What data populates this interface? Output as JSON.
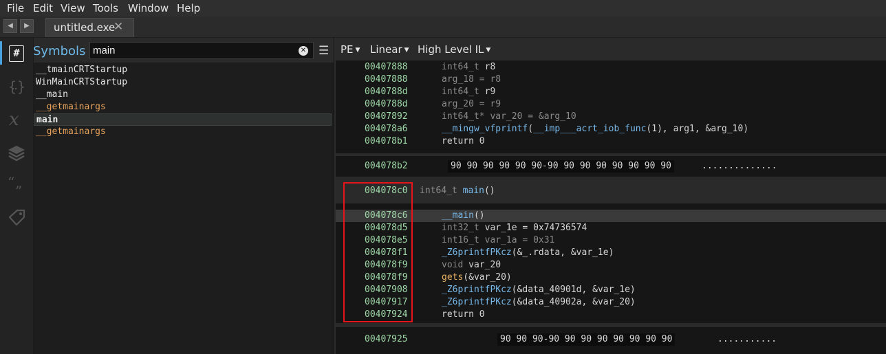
{
  "menu": [
    "File",
    "Edit",
    "View",
    "Tools",
    "Window",
    "Help"
  ],
  "tab": {
    "title": "untitled.exe",
    "close": "✕"
  },
  "nav": {
    "back": "◀",
    "forward": "▶"
  },
  "sidebar_icons": [
    "symbols-icon",
    "types-icon",
    "variables-icon",
    "layers-icon",
    "strings-icon",
    "tags-icon"
  ],
  "symbols": {
    "title": "Symbols",
    "search_value": "main",
    "items": [
      {
        "name": "__tmainCRTStartup",
        "kind": "function"
      },
      {
        "name": "WinMainCRTStartup",
        "kind": "function"
      },
      {
        "name": "__main",
        "kind": "function"
      },
      {
        "name": "__getmainargs",
        "kind": "import"
      },
      {
        "name": "main",
        "kind": "function",
        "selected": true
      },
      {
        "name": "__getmainargs",
        "kind": "import"
      }
    ]
  },
  "view": {
    "platform": "PE",
    "layout": "Linear",
    "il": "High Level IL"
  },
  "code": {
    "block1": [
      {
        "addr": "00407888",
        "type": "int64_t ",
        "text": "r8"
      },
      {
        "addr": "00407888",
        "type": "",
        "text": "arg_18 = r8",
        "dim": true
      },
      {
        "addr": "0040788d",
        "type": "int64_t ",
        "text": "r9"
      },
      {
        "addr": "0040788d",
        "type": "",
        "text": "arg_20 = r9",
        "dim": true
      },
      {
        "addr": "00407892",
        "type": "int64_t* ",
        "text": "var_20 = &arg_10",
        "dim": true
      },
      {
        "addr": "004078a6",
        "fn": "__mingw_vfprintf",
        "fn_pre": "",
        "text": "(",
        "fn2": "__imp___acrt_iob_func",
        "rest": "(1), arg1, &arg_10)"
      },
      {
        "addr": "004078b1",
        "type": "",
        "text": "return 0"
      }
    ],
    "data1": {
      "addr": "004078b2",
      "hex": "90 90 90 90 90 90-90 90 90 90 90 90 90 90",
      "ascii": ".............."
    },
    "func_header": {
      "addr": "004078c0",
      "ret": "int64_t ",
      "name": "main",
      "args": "()"
    },
    "block2": [
      {
        "addr": "004078c6",
        "call": "__main",
        "after": "()",
        "highlight": true
      },
      {
        "addr": "004078d5",
        "type": "int32_t ",
        "text": "var_1e = 0x74736574"
      },
      {
        "addr": "004078e5",
        "type": "int16_t ",
        "text": "var_1a = 0x31"
      },
      {
        "addr": "004078f1",
        "call": "_Z6printfPKcz",
        "after": "(&_.rdata, &var_1e)"
      },
      {
        "addr": "004078f9",
        "type": "void ",
        "text": "var_20"
      },
      {
        "addr": "004078f9",
        "call": "gets",
        "after": "(&var_20)",
        "plain_call": true
      },
      {
        "addr": "00407908",
        "call": "_Z6printfPKcz",
        "after": "(&data_40901d, &var_1e)"
      },
      {
        "addr": "00407917",
        "call": "_Z6printfPKcz",
        "after": "(&data_40902a, &var_20)"
      },
      {
        "addr": "00407924",
        "type": "",
        "text": "return 0"
      }
    ],
    "data2": {
      "addr": "00407925",
      "hex": "90 90 90-90 90 90 90 90 90 90 90",
      "ascii": "..........."
    }
  },
  "colors": {
    "address": "#9fd9a8",
    "function": "#78b9ea",
    "import": "#e8a35c",
    "annotation_box": "#e8141b"
  }
}
